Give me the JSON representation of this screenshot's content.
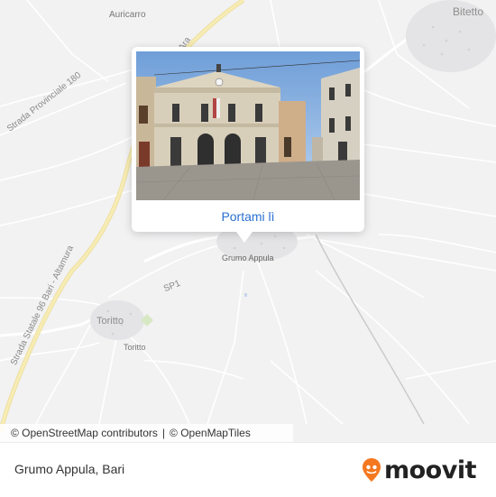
{
  "map": {
    "place_labels": {
      "auricarro": "Auricarro",
      "bitetto": "Bitetto",
      "grumo_appula": "Grumo Appula",
      "toritto": "Toritto",
      "toritto_small": "Toritto"
    },
    "road_labels": {
      "strada_provinciale": "Strada Provinciale 180",
      "strada_statale": "Strada Statale 96 Bari - Altamura",
      "sp1": "SP1",
      "murge_road": "Ara"
    },
    "colors": {
      "background": "#f2f2f3",
      "main_road": "#f5e9a6",
      "secondary_road": "#ffffff",
      "park": "#d9e8c4",
      "link": "#2b6fd1",
      "moovit_orange": "#f4781f"
    }
  },
  "popup": {
    "action_label": "Portami lì",
    "photo_icon": "town-hall-photo"
  },
  "attribution": {
    "osm_text": "© OpenStreetMap contributors",
    "separator": "|",
    "omt_text": "© OpenMapTiles"
  },
  "footer": {
    "title": "Grumo Appula, Bari",
    "brand": "moovit",
    "logo_icon": "moovit-pin-icon"
  }
}
